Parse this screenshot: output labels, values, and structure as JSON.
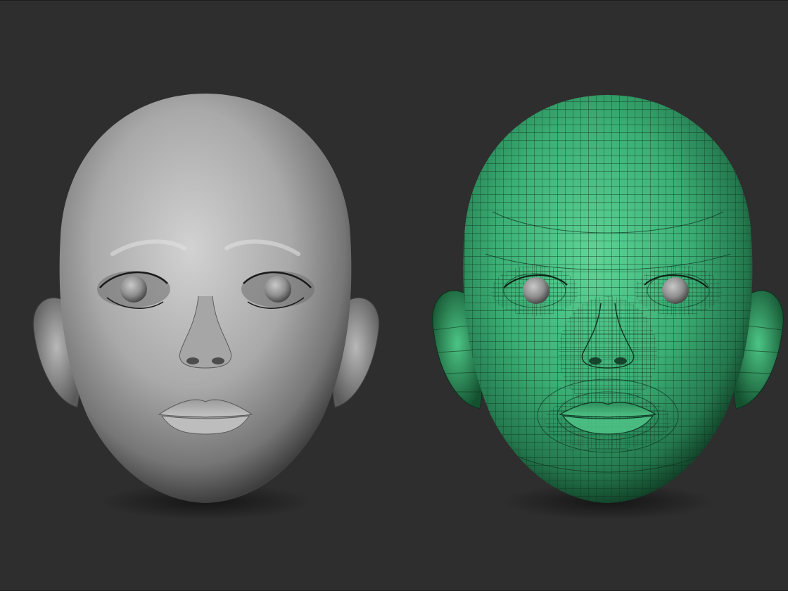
{
  "viewport": {
    "background": "#2e2e2e"
  },
  "models": [
    {
      "id": "head-smooth",
      "shading": "grey-matcap",
      "wireframe": false,
      "skin_color": "#8e8e8e",
      "skin_highlight": "#cfcfcf",
      "skin_shadow": "#3d3d3d"
    },
    {
      "id": "head-wireframe",
      "shading": "green-polyframe",
      "wireframe": true,
      "skin_color": "#2f9e67",
      "skin_highlight": "#6ee0a3",
      "skin_shadow": "#0d3d24",
      "wire_color": "#0f3320"
    }
  ],
  "eye_color": "#9a9a9a"
}
